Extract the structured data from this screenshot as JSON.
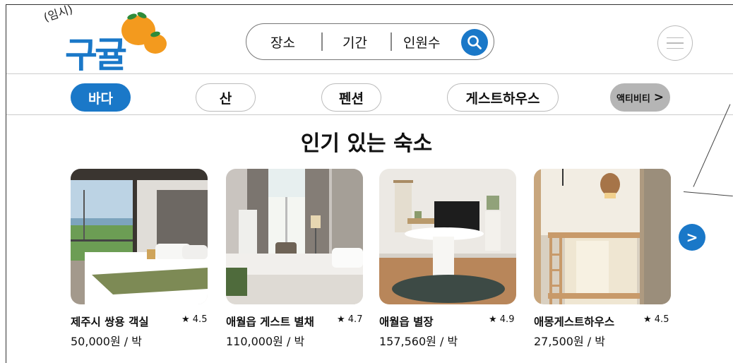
{
  "logo": {
    "sub": "(임시)",
    "title": "구귤"
  },
  "search": {
    "place": "장소",
    "period": "기간",
    "guests": "인원수",
    "button_icon": "search-icon"
  },
  "menu": {
    "icon": "hamburger-icon"
  },
  "categories": [
    {
      "label": "바다",
      "active": true
    },
    {
      "label": "산",
      "active": false
    },
    {
      "label": "펜션",
      "active": false
    },
    {
      "label": "게스트하우스",
      "active": false
    },
    {
      "label": "액티비티",
      "arrow": ">",
      "active": false
    }
  ],
  "section_title": "인기 있는 숙소",
  "cards": [
    {
      "name": "제주시 쌍용 객실",
      "rating": "★ 4.5",
      "price": "50,000원 / 박"
    },
    {
      "name": "애월읍 게스트 별채",
      "rating": "★ 4.7",
      "price": "110,000원 / 박"
    },
    {
      "name": "애월읍 별장",
      "rating": "★ 4.9",
      "price": "157,560원 / 박"
    },
    {
      "name": "애몽게스트하우스",
      "rating": "★ 4.5",
      "price": "27,500원 / 박"
    }
  ],
  "next_button": ">",
  "colors": {
    "brand_blue": "#1a78c8",
    "orange": "#f39a1e",
    "leaf_green": "#2e8b3a"
  }
}
